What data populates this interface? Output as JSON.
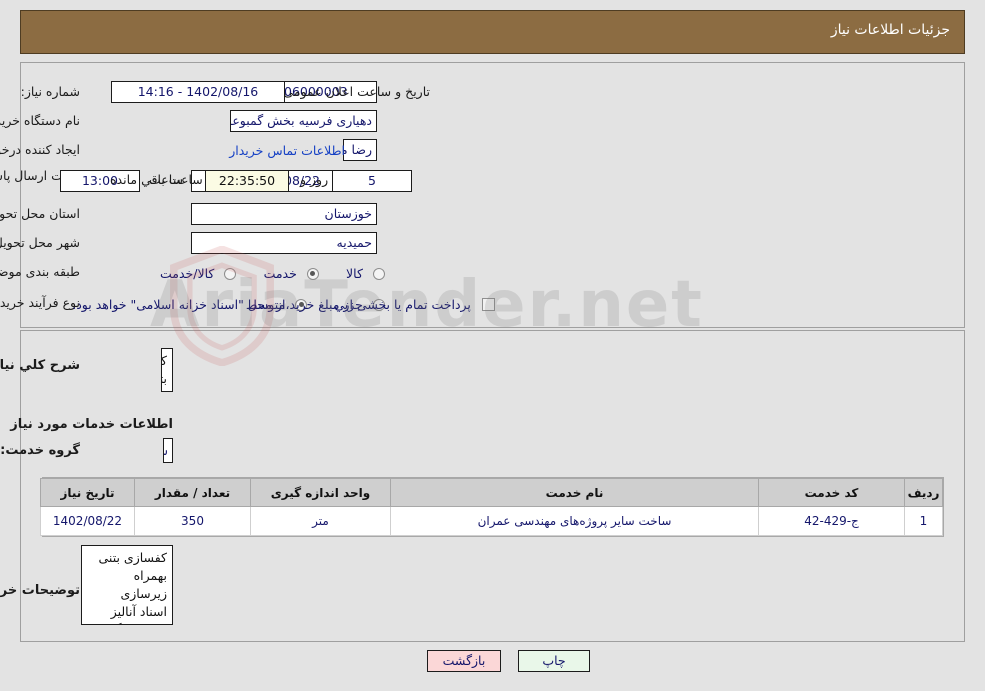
{
  "header": {
    "title": "جزئیات اطلاعات نیاز"
  },
  "form": {
    "need_number_label": "شماره نیاز:",
    "need_number_value": "1102105406000003",
    "announce_datetime_label": "تاریخ و ساعت اعلان عمومی:",
    "announce_datetime_value": "1402/08/16 - 14:16",
    "buyer_org_label": "نام دستگاه خریدار:",
    "buyer_org_value": "دهیاری فرسیه بخش گمبوعه شهرستان حمیدیه",
    "requester_label": "ایجاد کننده درخواست:",
    "requester_value": "رضا مشیعل فنی دهیاری فرسیه بخش گمبوعه شهرستان حمیدیه",
    "contact_link": "اطلاعات تماس خریدار",
    "deadline_label": "مهلت ارسال پاسخ: تا تاریخ:",
    "deadline_date": "1402/08/22",
    "deadline_hour_label": "ساعت",
    "deadline_hour": "13:00",
    "remaining_days": "5",
    "remaining_days_label": "روز و",
    "remaining_time": "22:35:50",
    "remaining_time_label": "ساعت باقي مانده",
    "province_label": "استان محل تحویل:",
    "province_value": "خوزستان",
    "city_label": "شهر محل تحویل:",
    "city_value": "حمیدیه",
    "category_label": "طبقه بندی موضوعی:",
    "category_options": [
      "کالا",
      "خدمت",
      "کالا/خدمت"
    ],
    "category_selected": "خدمت",
    "process_label": "نوع فرآیند خرید :",
    "process_options": [
      "جزیي",
      "متوسط"
    ],
    "process_selected": "متوسط",
    "treasury_checkbox_text": "پرداخت تمام یا بخشی از مبلغ خرید،از محل \"اسناد خزانه اسلامی\" خواهد بود.",
    "treasury_checked": false
  },
  "details": {
    "general_desc_label": "شرح کلي نیاز:",
    "general_desc_value": "کفسازی بتنی بهمراه زیرسازی",
    "services_section_title": "اطلاعات خدمات مورد نیاز",
    "service_group_label": "گروه خدمت:",
    "service_group_value": "ساختمان",
    "buyer_notes_label": "توضیحات خریدار:",
    "buyer_notes_value": "کفسازی بتنی بهمراه زیرسازی\nاسناد آنالیز الزاما بارگذاری شود"
  },
  "table": {
    "headers": [
      "ردیف",
      "کد خدمت",
      "نام خدمت",
      "واحد اندازه گیری",
      "تعداد / مقدار",
      "تاریخ نیاز"
    ],
    "rows": [
      {
        "row": "1",
        "code": "ج-429-42",
        "name": "ساخت سایر پروژه‌های مهندسی عمران",
        "unit": "متر",
        "quantity": "350",
        "date": "1402/08/22"
      }
    ]
  },
  "footer": {
    "print_label": "چاپ",
    "back_label": "بازگشت"
  },
  "watermark": {
    "text": "AriaTender.net"
  },
  "colors": {
    "header_bg": "#8c6c42",
    "link": "#1540c4",
    "value_text": "#14166b",
    "print_btn": "#e9f7e9",
    "back_btn": "#fbd7d7",
    "countdown_bg": "#fbfbe4"
  }
}
